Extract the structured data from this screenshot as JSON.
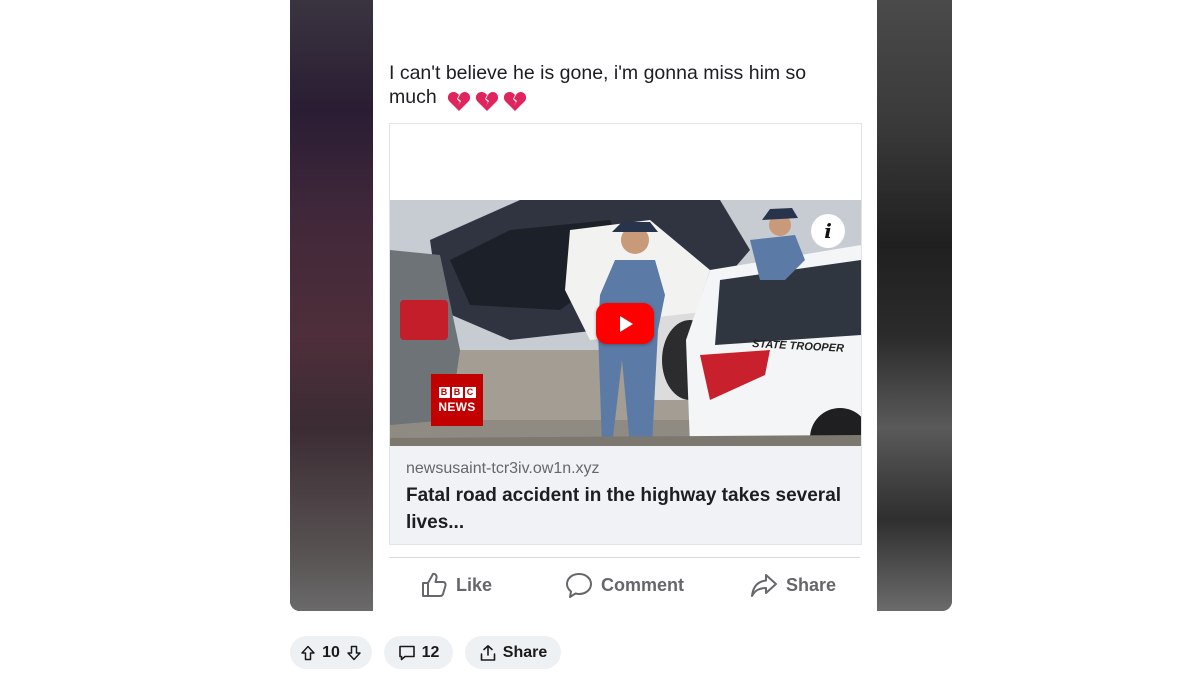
{
  "post": {
    "text": "I can't believe he is gone, i'm gonna miss him so much",
    "emoji": [
      "broken-heart",
      "broken-heart",
      "broken-heart"
    ]
  },
  "link_card": {
    "domain": "newsusaint-tcr3iv.ow1n.xyz",
    "title": "Fatal road accident in the highway takes several lives...",
    "badge_top": "BBC",
    "badge_bottom": "NEWS",
    "vehicle_text": "STATE TROOPER",
    "info_icon": "i"
  },
  "actions": {
    "like": "Like",
    "comment": "Comment",
    "share": "Share"
  },
  "reddit_bar": {
    "vote_count": "10",
    "comment_count": "12",
    "share_label": "Share"
  },
  "colors": {
    "play": "#ff0000",
    "bbc_red": "#c20000",
    "heart_red": "#e0245e",
    "pill_bg": "#eef1f3"
  }
}
